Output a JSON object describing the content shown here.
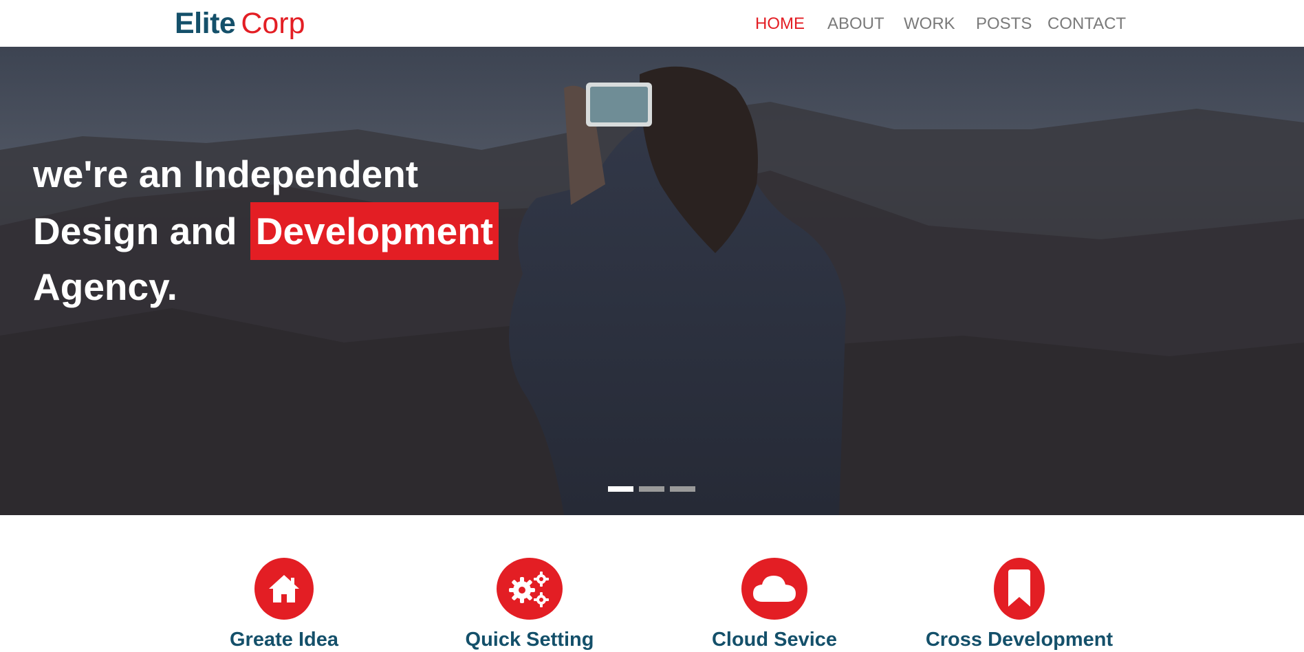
{
  "brand": {
    "first": "Elite",
    "second": "Corp"
  },
  "nav": {
    "items": [
      {
        "label": "HOME",
        "active": true
      },
      {
        "label": "ABOUT",
        "active": false
      },
      {
        "label": "WORK",
        "active": false
      },
      {
        "label": "POSTS",
        "active": false
      },
      {
        "label": "CONTACT",
        "active": false
      }
    ]
  },
  "hero": {
    "line1": "we're an Independent",
    "line2_prefix": "Design and",
    "line2_highlight": "Development",
    "line3": "Agency.",
    "slides_total": 3,
    "active_slide": 1
  },
  "features": [
    {
      "title": "Greate Idea",
      "icon": "home-icon"
    },
    {
      "title": "Quick Setting",
      "icon": "gears-icon"
    },
    {
      "title": "Cloud Sevice",
      "icon": "cloud-icon"
    },
    {
      "title": "Cross Development",
      "icon": "bookmark-icon"
    }
  ],
  "colors": {
    "accent": "#e31e24",
    "brand_dark": "#14506a",
    "nav_text": "#7a7a7a"
  }
}
